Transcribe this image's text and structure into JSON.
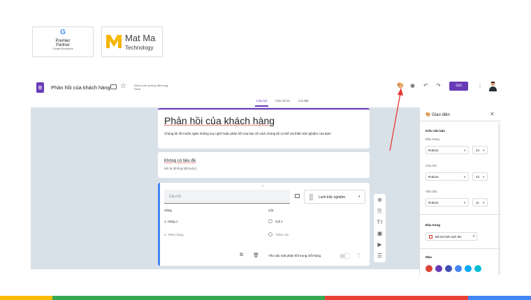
{
  "logos": {
    "google": {
      "g": "G",
      "line1": "...",
      "line2": "Premier",
      "line3": "Partner",
      "line4": "Google Workspace"
    },
    "matma": {
      "name": "Mat Ma",
      "sub": "Technology"
    }
  },
  "header": {
    "title": "Phản hồi của khách hàng",
    "saved_line1": "Đã lưu tất cả thay đổi trong",
    "saved_line2": "Drive",
    "send_label": "Gửi",
    "icons": [
      "palette-icon",
      "preview-icon",
      "undo-icon",
      "redo-icon",
      "more-icon"
    ]
  },
  "tabs": [
    {
      "label": "Câu hỏi",
      "active": true
    },
    {
      "label": "Câu trả lời",
      "active": false
    },
    {
      "label": "Cài đặt",
      "active": false
    }
  ],
  "form": {
    "title": "Phản hồi của khách hàng",
    "description": "Chúng tôi rất muốn nghe những suy nghĩ hoặc phản hồi của bạn về cách chúng tôi có thể cải thiện trải nghiệm của bạn!",
    "section_title": "Không có tiêu đề",
    "section_desc": "Mô tả (không bắt buộc)",
    "question": {
      "placeholder": "Câu hỏi",
      "type": "Lưới trắc nghiệm",
      "rows_header": "Hàng",
      "cols_header": "Cột",
      "row1": "1.  Hàng 1",
      "row_add": "2.  Thêm hàng",
      "col1": "Cột 1",
      "col_add": "Thêm cột",
      "require_label": "Yêu cầu một phản hồi trong mỗi hàng"
    }
  },
  "theme_panel": {
    "title": "Giao diện",
    "text_style": "Kiểu văn bản",
    "header_label": "Đầu trang",
    "header_font": "Roboto",
    "header_size": "24",
    "question_label": "Câu hỏi",
    "question_font": "Roboto",
    "question_size": "12",
    "text_label": "Văn bản",
    "text_font": "Roboto",
    "text_size": "11",
    "header_image_section": "Đầu trang",
    "upload_label": "Đã tải hình ảnh lên",
    "color_section": "Màu",
    "colors": [
      "#db4437",
      "#673ab7",
      "#3f51b5",
      "#4285f4",
      "#03a9f4",
      "#00bcd4"
    ]
  },
  "colors": {
    "accent": "#673ab7",
    "canvas": "#d9e1e8",
    "arrow": "#e53935"
  }
}
